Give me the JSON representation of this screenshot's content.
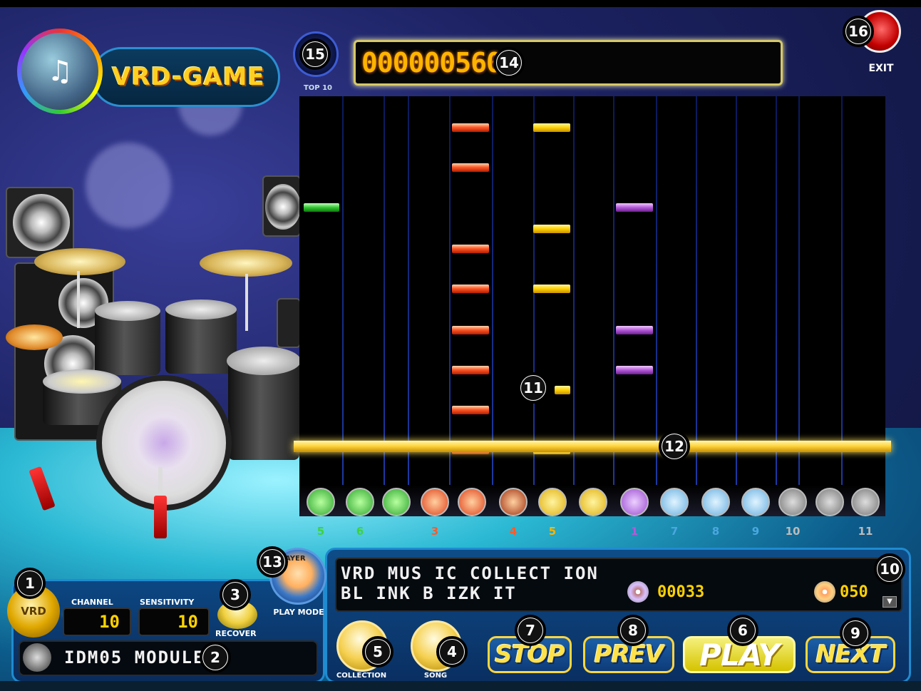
{
  "app": {
    "logo_text": "VRD-GAME"
  },
  "header": {
    "top10_label": "TOP 10",
    "score": "0000005600",
    "exit_label": "EXIT"
  },
  "highway": {
    "pad_numbers": [
      "5",
      "6",
      "3",
      "4",
      "5",
      "1",
      "7",
      "8",
      "9",
      "10",
      "11"
    ]
  },
  "music": {
    "line1": "VRD MUS IC COLLECT ION",
    "line2": "BL INK B IZK IT",
    "counter1": "00033",
    "counter2": "050"
  },
  "left_panel": {
    "vrd_label": "VRD",
    "channel_label": "CHANNEL",
    "channel_value": "10",
    "sensitivity_label": "SENSITIVITY",
    "sensitivity_value": "10",
    "recover_label": "RECOVER",
    "module_text": "IDM05 MODULE"
  },
  "player": {
    "badge": "AYER",
    "play_mode_label": "PLAY MODE"
  },
  "buttons": {
    "collection_label": "COLLECTION",
    "song_label": "SONG",
    "stop": "STOP",
    "prev": "PREV",
    "play": "PLAY",
    "next": "NEXT"
  },
  "callouts": [
    "1",
    "2",
    "3",
    "4",
    "5",
    "6",
    "7",
    "8",
    "9",
    "10",
    "11",
    "12",
    "13",
    "14",
    "15",
    "16"
  ],
  "colors": {
    "accent_gold": "#ffd200",
    "lane_blue": "#1e3ca8",
    "note_red": "#ff5b2a",
    "note_yellow": "#ffd000",
    "note_green": "#32c832",
    "note_purple": "#b45ad8"
  }
}
